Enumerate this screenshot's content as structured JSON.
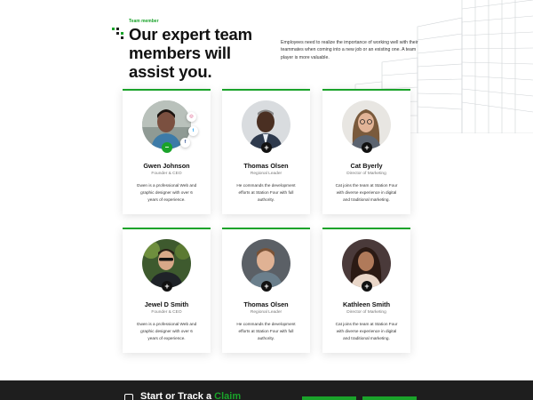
{
  "section": {
    "eyebrow": "Team member",
    "headline": "Our expert team members will assist you.",
    "intro": "Employees need to realize the importance of working well with their teammates when coming into a new job or an existing one. A team player is more valuable."
  },
  "members": [
    {
      "name": "Gwen Johnson",
      "role": "Founder & CEO",
      "bio": "Gwen is a professional Web and graphic designer with over 6 years of experience."
    },
    {
      "name": "Thomas Olsen",
      "role": "Regional Leader",
      "bio": "He commands the development efforts at Station Four with full authority."
    },
    {
      "name": "Cat Byerly",
      "role": "Director of Marketing",
      "bio": "Cat joins the team at Station Four with diverse experience in digital and traditional marketing."
    },
    {
      "name": "Jewel D Smith",
      "role": "Founder & CEO",
      "bio": "Gwen is a professional Web and graphic designer with over 6 years of experience."
    },
    {
      "name": "Thomas Olsen",
      "role": "Regional Leader",
      "bio": "He commands the development efforts at Station Four with full authority."
    },
    {
      "name": "Kathleen Smith",
      "role": "Director of Marketing",
      "bio": "Cat joins the team at Station Four with diverse experience in digital and traditional marketing."
    }
  ],
  "card_actions": {
    "expand_label": "+",
    "collapse_label": "–"
  },
  "social_icons": [
    "instagram-icon",
    "twitter-icon",
    "facebook-icon"
  ],
  "social_glyphs": {
    "instagram": "◎",
    "twitter": "t",
    "facebook": "f"
  },
  "footer": {
    "text_prefix": "Start or Track a ",
    "text_highlight": "Claim"
  },
  "colors": {
    "accent": "#1aa32a",
    "footer_bg": "#1e1e1e",
    "text": "#111111"
  }
}
